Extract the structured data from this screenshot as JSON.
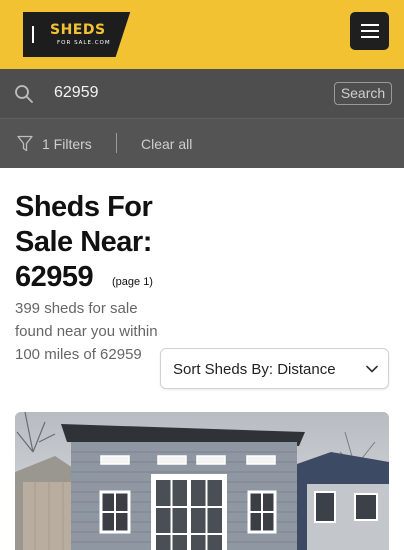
{
  "header": {
    "logo_text": "SHEDS",
    "logo_subtext": "FOR SALE.COM",
    "menu_icon": "hamburger-icon"
  },
  "search": {
    "icon": "search-icon",
    "value": "62959",
    "button_label": "Search"
  },
  "filters": {
    "icon": "filter-icon",
    "label": "1 Filters",
    "clear_label": "Clear all"
  },
  "main": {
    "title_line1": "Sheds For",
    "title_line2": "Sale Near:",
    "title_zip": "62959",
    "page_note": "(page 1)",
    "results_text": "399 sheds for sale found near you within 100 miles of 62959",
    "sort_label": "Sort Sheds By: Distance",
    "sort_icon": "chevron-down-icon"
  },
  "colors": {
    "header_bg": "#f2c233",
    "searchbar_bg": "#4e4e4e",
    "filterbar_bg": "#545454",
    "menu_button_bg": "#1f1f1f"
  }
}
